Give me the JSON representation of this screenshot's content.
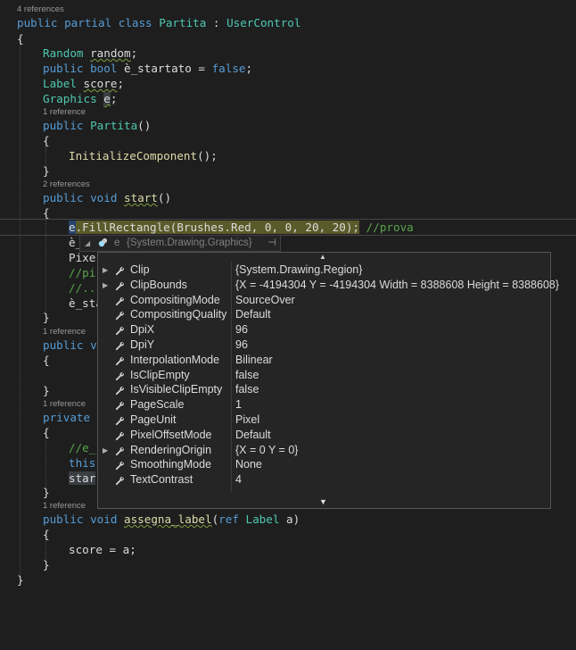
{
  "codelens": {
    "class_refs": "4 references",
    "ctor_refs": "1 reference",
    "start_refs": "2 references",
    "m1_refs": "1 reference",
    "m2_refs": "1 reference",
    "assegna_refs": "1 reference"
  },
  "code": {
    "class_kw": "public partial class ",
    "class_name": "Partita",
    "class_sep": " : ",
    "class_base": "UserControl",
    "open_brace": "{",
    "close_brace": "}",
    "field1_type": "Random",
    "field1_name": "random",
    "field1_semi": ";",
    "field2_kw": "public bool ",
    "field2_rest": "è_startato = ",
    "field2_val": "false",
    "field2_semi": ";",
    "field3_type": "Label",
    "field3_name": "score",
    "field3_semi": ";",
    "field4_type": "Graphics",
    "field4_sp": " ",
    "field4_name": "e",
    "field4_semi": ";",
    "ctor_kw": "public ",
    "ctor_name": "Partita",
    "ctor_parens": "()",
    "init_call": "InitializeComponent",
    "init_tail": "();",
    "start_kw": "public void ",
    "start_name": "start",
    "start_parens": "()",
    "fill_var": "e",
    "fill_method": ".FillRectangle(",
    "fill_brushes": "Brushes",
    "fill_red": ".Red, ",
    "fill_nums": "0, 0, 20, 20",
    "fill_tail": ");",
    "fill_comment": " //prova",
    "l_e": "è_",
    "l_pixe": "Pixe",
    "l_cm1": "//pi",
    "l_cm2": "//..",
    "l_esta": "è_sta",
    "m1_kw": "public vo",
    "m2_kw": "private v",
    "l_cm3": "//e_",
    "l_this": "this",
    "l_star": "star",
    "assegna_kw": "public void ",
    "assegna_name": "assegna_label",
    "assegna_open": "(",
    "assegna_ref": "ref ",
    "assegna_type": "Label",
    "assegna_rest": " a)",
    "score_stmt": "score = a;"
  },
  "datatip": {
    "var_name": "e",
    "var_value": "{System.Drawing.Graphics}",
    "pin_glyph": "⊣",
    "properties": [
      {
        "name": "Clip",
        "value": "{System.Drawing.Region}",
        "expandable": true
      },
      {
        "name": "ClipBounds",
        "value": "{X = -4194304 Y = -4194304 Width = 8388608 Height = 8388608}",
        "expandable": true
      },
      {
        "name": "CompositingMode",
        "value": "SourceOver",
        "expandable": false
      },
      {
        "name": "CompositingQuality",
        "value": "Default",
        "expandable": false
      },
      {
        "name": "DpiX",
        "value": "96",
        "expandable": false
      },
      {
        "name": "DpiY",
        "value": "96",
        "expandable": false
      },
      {
        "name": "InterpolationMode",
        "value": "Bilinear",
        "expandable": false
      },
      {
        "name": "IsClipEmpty",
        "value": "false",
        "expandable": false
      },
      {
        "name": "IsVisibleClipEmpty",
        "value": "false",
        "expandable": false
      },
      {
        "name": "PageScale",
        "value": "1",
        "expandable": false
      },
      {
        "name": "PageUnit",
        "value": "Pixel",
        "expandable": false
      },
      {
        "name": "PixelOffsetMode",
        "value": "Default",
        "expandable": false
      },
      {
        "name": "RenderingOrigin",
        "value": "{X = 0 Y = 0}",
        "expandable": true
      },
      {
        "name": "SmoothingMode",
        "value": "None",
        "expandable": false
      },
      {
        "name": "TextContrast",
        "value": "4",
        "expandable": false
      }
    ]
  },
  "colors": {
    "background": "#1e1e1e",
    "keyword": "#569cd6",
    "type": "#4ec9b0",
    "method": "#dcdcaa",
    "number": "#b5cea8",
    "comment": "#57a64a"
  }
}
